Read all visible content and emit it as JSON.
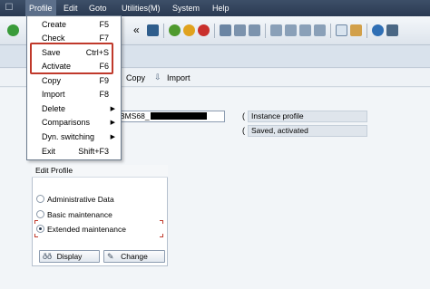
{
  "menubar": {
    "system_icon": "window-menu-icon",
    "items": [
      {
        "label": "Profile"
      },
      {
        "label": "Edit"
      },
      {
        "label": "Goto"
      },
      {
        "label": "Utilities(M)"
      },
      {
        "label": "System"
      },
      {
        "label": "Help"
      }
    ]
  },
  "toolbar": {
    "back_label": "«"
  },
  "app_toolbar": {
    "copy_label": "Copy",
    "import_label": "Import"
  },
  "fields": {
    "profile_prefix": "BMS68_",
    "profile_type": "Instance profile",
    "profile_status": "Saved, activated"
  },
  "edit_profile": {
    "title": "Edit Profile",
    "options": [
      {
        "label": "Administrative Data",
        "selected": false
      },
      {
        "label": "Basic maintenance",
        "selected": false
      },
      {
        "label": "Extended maintenance",
        "selected": true
      }
    ],
    "display_label": "Display",
    "change_label": "Change"
  },
  "dropdown": {
    "items": [
      {
        "label": "Create",
        "shortcut": "F5",
        "submenu": false
      },
      {
        "label": "Check",
        "shortcut": "F7",
        "submenu": false
      },
      {
        "label": "Save",
        "shortcut": "Ctrl+S",
        "submenu": false
      },
      {
        "label": "Activate",
        "shortcut": "F6",
        "submenu": false
      },
      {
        "label": "Copy",
        "shortcut": "F9",
        "submenu": false
      },
      {
        "label": "Import",
        "shortcut": "F8",
        "submenu": false
      },
      {
        "label": "Delete",
        "shortcut": "",
        "submenu": true
      },
      {
        "label": "Comparisons",
        "shortcut": "",
        "submenu": true
      },
      {
        "label": "Dyn. switching",
        "shortcut": "",
        "submenu": true
      },
      {
        "label": "Exit",
        "shortcut": "Shift+F3",
        "submenu": false
      }
    ]
  }
}
